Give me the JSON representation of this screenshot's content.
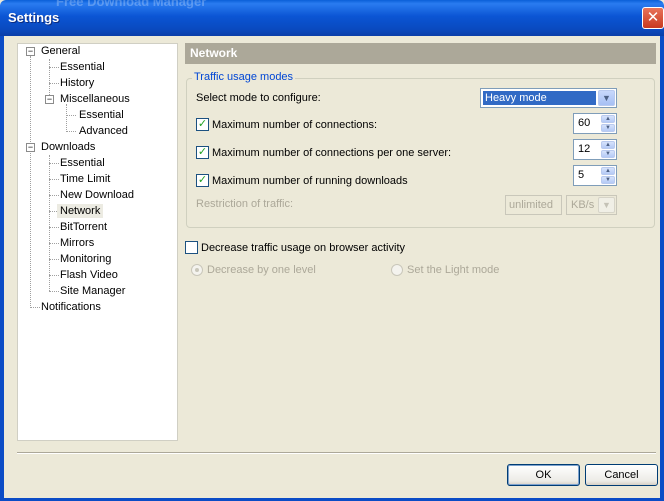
{
  "window": {
    "title": "Settings",
    "background_title": "Free Download Manager",
    "close_glyph": "✕"
  },
  "tree": {
    "items": [
      {
        "label": "General",
        "level": 0,
        "expander": "−"
      },
      {
        "label": "Essential",
        "level": 1
      },
      {
        "label": "History",
        "level": 1
      },
      {
        "label": "Miscellaneous",
        "level": 1,
        "expander": "−"
      },
      {
        "label": "Essential",
        "level": 2
      },
      {
        "label": "Advanced",
        "level": 2
      },
      {
        "label": "Downloads",
        "level": 0,
        "expander": "−"
      },
      {
        "label": "Essential",
        "level": 1
      },
      {
        "label": "Time Limit",
        "level": 1
      },
      {
        "label": "New Download",
        "level": 1
      },
      {
        "label": "Network",
        "level": 1,
        "selected": true
      },
      {
        "label": "BitTorrent",
        "level": 1
      },
      {
        "label": "Mirrors",
        "level": 1
      },
      {
        "label": "Monitoring",
        "level": 1
      },
      {
        "label": "Flash Video",
        "level": 1
      },
      {
        "label": "Site Manager",
        "level": 1
      },
      {
        "label": "Notifications",
        "level": 0
      }
    ]
  },
  "panel": {
    "title": "Network",
    "group_title": "Traffic usage modes",
    "mode_label": "Select mode to configure:",
    "mode_value": "Heavy mode",
    "dropdown_glyph": "▼",
    "check_glyph": "✓",
    "spin_up_glyph": "▲",
    "spin_down_glyph": "▼",
    "settings": [
      {
        "label": "Maximum number of connections:",
        "checked": true,
        "value": "60"
      },
      {
        "label": "Maximum number of connections per one server:",
        "checked": true,
        "value": "12"
      },
      {
        "label": "Maximum number of running downloads",
        "checked": true,
        "value": "5"
      }
    ],
    "restriction_label": "Restriction of traffic:",
    "restriction_value": "unlimited",
    "restriction_unit": "KB/s",
    "decrease_label": "Decrease traffic usage on browser activity",
    "decrease_checked": false,
    "radio_one_level": "Decrease by one level",
    "radio_light_mode": "Set the Light mode"
  },
  "buttons": {
    "ok": "OK",
    "cancel": "Cancel"
  },
  "colors": {
    "accent": "#0046d5",
    "titlebar": "#0b55d4",
    "selection": "#316ac5",
    "section_header": "#aca899"
  }
}
